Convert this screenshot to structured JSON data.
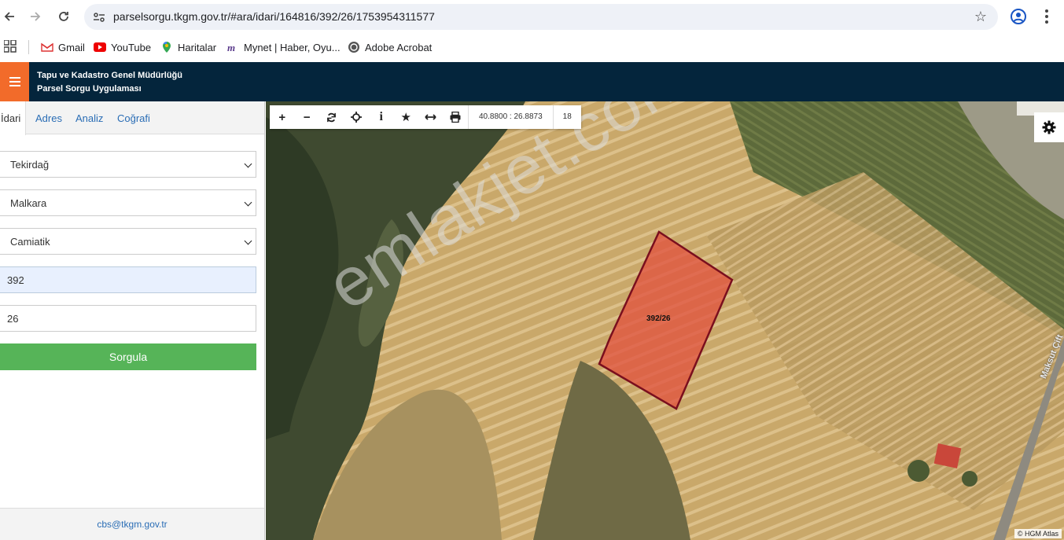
{
  "browser": {
    "url": "parselsorgu.tkgm.gov.tr/#ara/idari/164816/392/26/1753954311577",
    "bookmarks": [
      {
        "label": "Gmail",
        "icon": "gmail-icon"
      },
      {
        "label": "YouTube",
        "icon": "youtube-icon"
      },
      {
        "label": "Haritalar",
        "icon": "maps-icon"
      },
      {
        "label": "Mynet | Haber, Oyu...",
        "icon": "mynet-icon"
      },
      {
        "label": "Adobe Acrobat",
        "icon": "acrobat-icon"
      }
    ]
  },
  "app": {
    "title_line1": "Tapu ve Kadastro Genel Müdürlüğü",
    "title_line2": "Parsel Sorgu Uygulaması",
    "accent_color": "#f26b2a",
    "header_color": "#04253c"
  },
  "panel": {
    "tabs": [
      "İdari",
      "Adres",
      "Analiz",
      "Coğrafi"
    ],
    "active_tab": "İdari",
    "il": "Tekirdağ",
    "ilce": "Malkara",
    "mahalle": "Camiatik",
    "ada": "392",
    "parsel": "26",
    "submit_label": "Sorgula",
    "submit_color": "#56b458",
    "footer_email": "cbs@tkgm.gov.tr"
  },
  "map": {
    "tools": [
      "zoom-in-icon",
      "zoom-out-icon",
      "refresh-icon",
      "locate-icon",
      "info-icon",
      "favorite-icon",
      "measure-icon",
      "print-icon"
    ],
    "coordinates": "40.8800 : 26.8873",
    "zoom_level": "18",
    "parcel_label": "392/26",
    "watermark": "emlakjet.com",
    "road_label": "Maksut Çift",
    "attribution": "© HGM Atlas"
  }
}
